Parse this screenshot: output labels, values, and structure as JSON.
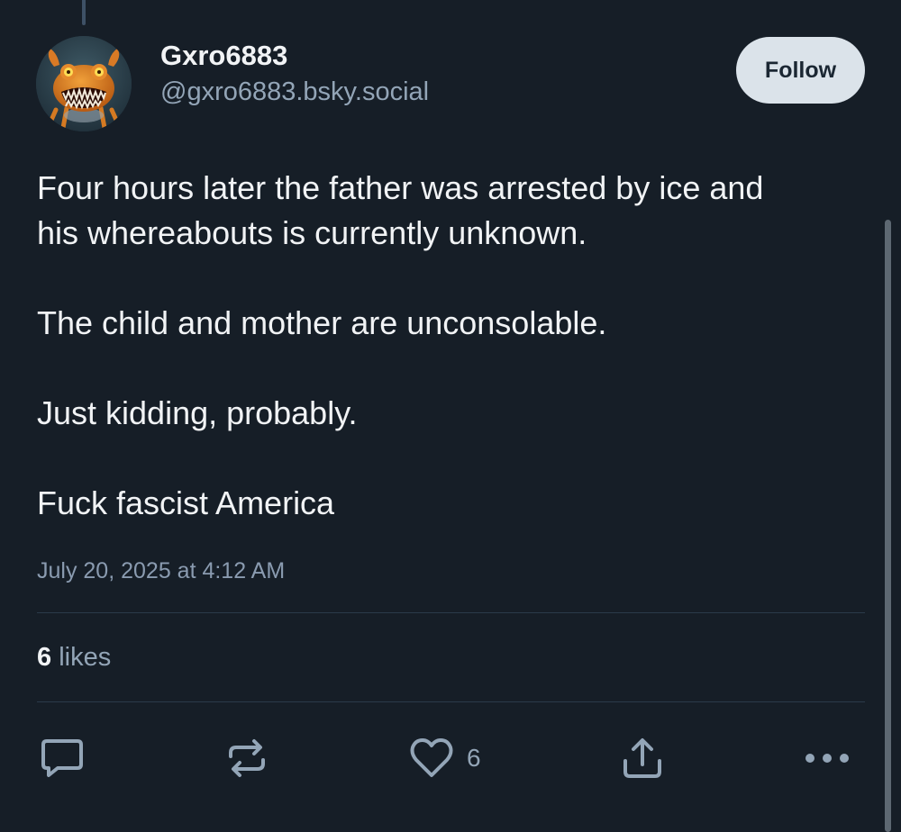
{
  "post": {
    "author": {
      "display_name": "Gxro6883",
      "handle": "@gxro6883.bsky.social",
      "avatar_icon": "orange-creature-avatar"
    },
    "follow_label": "Follow",
    "text_paragraphs": [
      "Four hours later the father was arrested by ice and",
      "his whereabouts is currently unknown.",
      "The child and mother are unconsolable.",
      "Just kidding, probably.",
      "Fuck fascist America"
    ],
    "timestamp": "July 20, 2025 at 4:12 AM",
    "stats": {
      "likes_count": "6",
      "likes_label": "likes"
    },
    "actions": {
      "reply_icon": "speech-bubble-icon",
      "repost_icon": "repost-arrows-icon",
      "like_icon": "heart-icon",
      "like_count": "6",
      "share_icon": "share-upload-icon",
      "more_icon": "ellipsis-icon"
    }
  },
  "colors": {
    "background": "#161e27",
    "text_primary": "#f1f3f5",
    "text_secondary": "#93a5b7",
    "follow_button_bg": "#dbe3ea",
    "divider": "#2b3a4a"
  }
}
